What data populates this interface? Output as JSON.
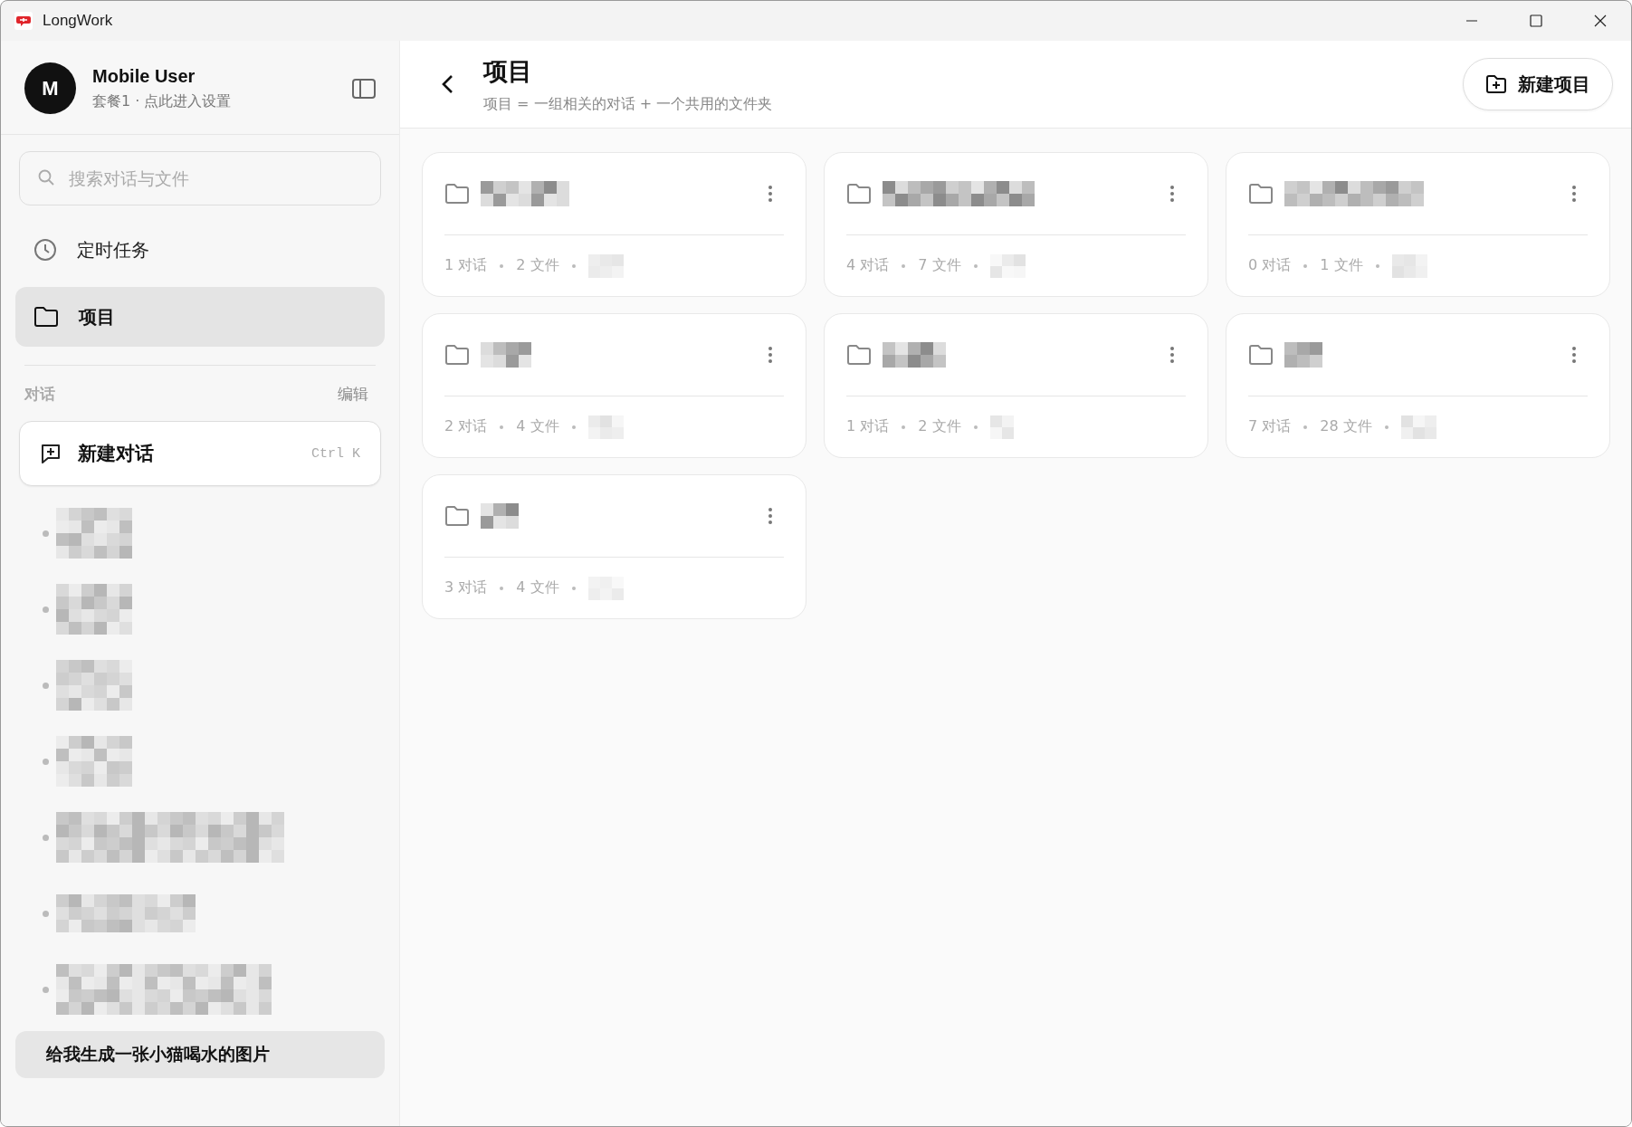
{
  "window": {
    "title": "LongWork"
  },
  "user": {
    "avatar_initial": "M",
    "name": "Mobile User",
    "subtitle": "套餐1 · 点此进入设置"
  },
  "search": {
    "placeholder": "搜索对话与文件"
  },
  "nav": [
    {
      "label": "定时任务",
      "kind": "clock",
      "selected": false
    },
    {
      "label": "项目",
      "kind": "folder",
      "selected": true
    }
  ],
  "conversations": {
    "title": "对话",
    "edit": "编辑",
    "new_chat": {
      "label": "新建对话",
      "shortcut": "Ctrl K"
    },
    "items": [
      {
        "kind": "redacted",
        "selected": false
      },
      {
        "kind": "redacted",
        "selected": false
      },
      {
        "kind": "redacted",
        "selected": false
      },
      {
        "kind": "redacted",
        "selected": false
      },
      {
        "kind": "redacted",
        "selected": false
      },
      {
        "kind": "redacted",
        "selected": false
      },
      {
        "kind": "redacted",
        "selected": false
      },
      {
        "kind": "text",
        "label": "给我生成一张小猫喝水的图片",
        "selected": true
      }
    ]
  },
  "header": {
    "title": "项目",
    "subtitle": "项目 = 一组相关的对话 + 一个共用的文件夹",
    "new_button": "新建项目"
  },
  "projects": [
    {
      "chats": "1 对话",
      "files": "2 文件"
    },
    {
      "chats": "4 对话",
      "files": "7 文件"
    },
    {
      "chats": "0 对话",
      "files": "1 文件"
    },
    {
      "chats": "2 对话",
      "files": "4 文件"
    },
    {
      "chats": "1 对话",
      "files": "2 文件"
    },
    {
      "chats": "7 对话",
      "files": "28 文件"
    },
    {
      "chats": "3 对话",
      "files": "4 文件"
    }
  ]
}
